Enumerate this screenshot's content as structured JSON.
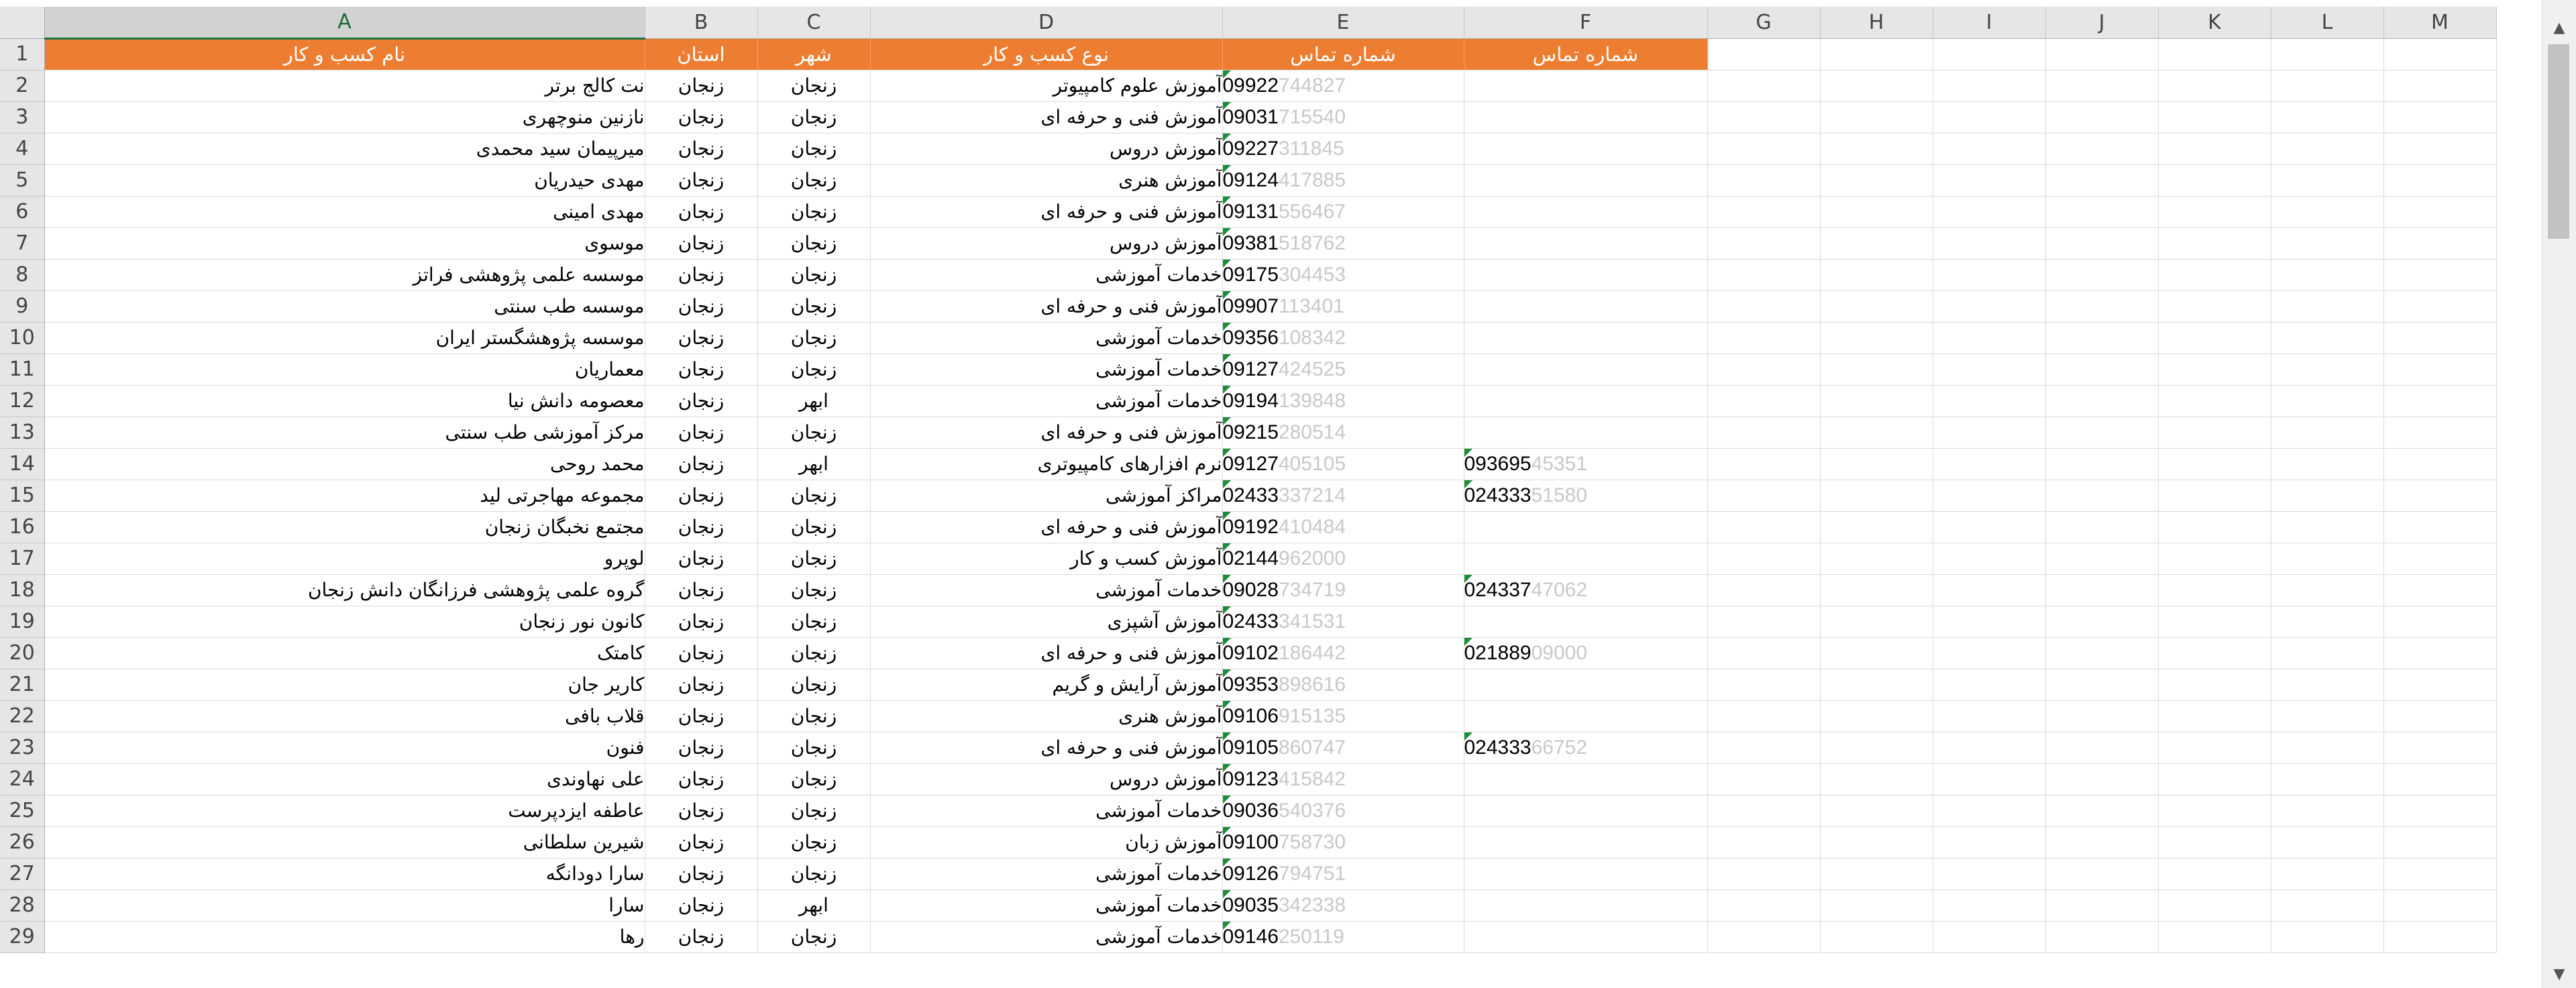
{
  "sheet": {
    "columns": [
      "A",
      "B",
      "C",
      "D",
      "E",
      "F",
      "G",
      "H",
      "I",
      "J",
      "K",
      "L",
      "M"
    ],
    "selected_column": "A",
    "header_row": {
      "row": 1,
      "A": "نام کسب و کار",
      "B": "استان",
      "C": "شهر",
      "D": "نوع کسب و کار",
      "E": "شماره تماس",
      "F": "شماره تماس"
    },
    "rows": [
      {
        "row": 2,
        "A": "نت کالج برتر",
        "B": "زنجان",
        "C": "زنجان",
        "D": "آموزش علوم کامپیوتر",
        "E": "09922",
        "E_fade": "744827",
        "F": "",
        "F_fade": ""
      },
      {
        "row": 3,
        "A": "نازنین منوچهری",
        "B": "زنجان",
        "C": "زنجان",
        "D": "آموزش فنی و حرفه ای",
        "E": "09031",
        "E_fade": "715540",
        "F": "",
        "F_fade": ""
      },
      {
        "row": 4,
        "A": "میرپیمان سید محمدی",
        "B": "زنجان",
        "C": "زنجان",
        "D": "آموزش دروس",
        "E": "09227",
        "E_fade": "311845",
        "F": "",
        "F_fade": ""
      },
      {
        "row": 5,
        "A": "مهدی حیدریان",
        "B": "زنجان",
        "C": "زنجان",
        "D": "آموزش هنری",
        "E": "09124",
        "E_fade": "417885",
        "F": "",
        "F_fade": ""
      },
      {
        "row": 6,
        "A": "مهدی امینی",
        "B": "زنجان",
        "C": "زنجان",
        "D": "آموزش فنی و حرفه ای",
        "E": "09131",
        "E_fade": "556467",
        "F": "",
        "F_fade": ""
      },
      {
        "row": 7,
        "A": "موسوی",
        "B": "زنجان",
        "C": "زنجان",
        "D": "آموزش دروس",
        "E": "09381",
        "E_fade": "518762",
        "F": "",
        "F_fade": ""
      },
      {
        "row": 8,
        "A": "موسسه علمی پژوهشی فراتز",
        "B": "زنجان",
        "C": "زنجان",
        "D": "خدمات آموزشی",
        "E": "09175",
        "E_fade": "304453",
        "F": "",
        "F_fade": ""
      },
      {
        "row": 9,
        "A": "موسسه طب سنتی",
        "B": "زنجان",
        "C": "زنجان",
        "D": "آموزش فنی و حرفه ای",
        "E": "09907",
        "E_fade": "113401",
        "F": "",
        "F_fade": ""
      },
      {
        "row": 10,
        "A": "موسسه پژوهشگستر ایران",
        "B": "زنجان",
        "C": "زنجان",
        "D": "خدمات آموزشی",
        "E": "09356",
        "E_fade": "108342",
        "F": "",
        "F_fade": ""
      },
      {
        "row": 11,
        "A": "معماریان",
        "B": "زنجان",
        "C": "زنجان",
        "D": "خدمات آموزشی",
        "E": "09127",
        "E_fade": "424525",
        "F": "",
        "F_fade": ""
      },
      {
        "row": 12,
        "A": "معصومه دانش نیا",
        "B": "زنجان",
        "C": "ابهر",
        "D": "خدمات آموزشی",
        "E": "09194",
        "E_fade": "139848",
        "F": "",
        "F_fade": ""
      },
      {
        "row": 13,
        "A": "مرکز آموزشی طب سنتی",
        "B": "زنجان",
        "C": "زنجان",
        "D": "آموزش فنی و حرفه ای",
        "E": "09215",
        "E_fade": "280514",
        "F": "",
        "F_fade": ""
      },
      {
        "row": 14,
        "A": "محمد روحی",
        "B": "زنجان",
        "C": "ابهر",
        "D": "نرم افزارهای کامپیوتری",
        "E": "09127",
        "E_fade": "405105",
        "F": "093695",
        "F_fade": "45351"
      },
      {
        "row": 15,
        "A": "مجموعه مهاجرتی لید",
        "B": "زنجان",
        "C": "زنجان",
        "D": "مراکز آموزشی",
        "E": "02433",
        "E_fade": "337214",
        "F": "024333",
        "F_fade": "51580"
      },
      {
        "row": 16,
        "A": "مجتمع نخبگان زنجان",
        "B": "زنجان",
        "C": "زنجان",
        "D": "آموزش فنی و حرفه ای",
        "E": "09192",
        "E_fade": "410484",
        "F": "",
        "F_fade": ""
      },
      {
        "row": 17,
        "A": "لوپرو",
        "B": "زنجان",
        "C": "زنجان",
        "D": "آموزش کسب و کار",
        "E": "02144",
        "E_fade": "962000",
        "F": "",
        "F_fade": ""
      },
      {
        "row": 18,
        "A": "گروه علمی پژوهشی فرزانگان دانش زنجان",
        "B": "زنجان",
        "C": "زنجان",
        "D": "خدمات آموزشی",
        "E": "09028",
        "E_fade": "734719",
        "F": "024337",
        "F_fade": "47062"
      },
      {
        "row": 19,
        "A": "کانون نور زنجان",
        "B": "زنجان",
        "C": "زنجان",
        "D": "آموزش آشپزی",
        "E": "02433",
        "E_fade": "341531",
        "F": "",
        "F_fade": ""
      },
      {
        "row": 20,
        "A": "کامتک",
        "B": "زنجان",
        "C": "زنجان",
        "D": "آموزش فنی و حرفه ای",
        "E": "09102",
        "E_fade": "186442",
        "F": "021889",
        "F_fade": "09000"
      },
      {
        "row": 21,
        "A": "کاریر جان",
        "B": "زنجان",
        "C": "زنجان",
        "D": "آموزش آرایش و گریم",
        "E": "09353",
        "E_fade": "898616",
        "F": "",
        "F_fade": ""
      },
      {
        "row": 22,
        "A": "قلاب بافی",
        "B": "زنجان",
        "C": "زنجان",
        "D": "آموزش هنری",
        "E": "09106",
        "E_fade": "915135",
        "F": "",
        "F_fade": ""
      },
      {
        "row": 23,
        "A": "فنون",
        "B": "زنجان",
        "C": "زنجان",
        "D": "آموزش فنی و حرفه ای",
        "E": "09105",
        "E_fade": "860747",
        "F": "024333",
        "F_fade": "66752"
      },
      {
        "row": 24,
        "A": "علی نهاوندی",
        "B": "زنجان",
        "C": "زنجان",
        "D": "آموزش دروس",
        "E": "09123",
        "E_fade": "415842",
        "F": "",
        "F_fade": ""
      },
      {
        "row": 25,
        "A": "عاطفه ایزدپرست",
        "B": "زنجان",
        "C": "زنجان",
        "D": "خدمات آموزشی",
        "E": "09036",
        "E_fade": "540376",
        "F": "",
        "F_fade": ""
      },
      {
        "row": 26,
        "A": "شیرین سلطانی",
        "B": "زنجان",
        "C": "زنجان",
        "D": "آموزش زبان",
        "E": "09100",
        "E_fade": "758730",
        "F": "",
        "F_fade": ""
      },
      {
        "row": 27,
        "A": "سارا دودانگه",
        "B": "زنجان",
        "C": "زنجان",
        "D": "خدمات آموزشی",
        "E": "09126",
        "E_fade": "794751",
        "F": "",
        "F_fade": ""
      },
      {
        "row": 28,
        "A": "سارا",
        "B": "زنجان",
        "C": "ابهر",
        "D": "خدمات آموزشی",
        "E": "09035",
        "E_fade": "342338",
        "F": "",
        "F_fade": ""
      },
      {
        "row": 29,
        "A": "رها",
        "B": "زنجان",
        "C": "زنجان",
        "D": "خدمات آموزشی",
        "E": "09146",
        "E_fade": "250119",
        "F": "",
        "F_fade": ""
      }
    ]
  },
  "colors": {
    "header_fill": "#ed7d31",
    "header_text": "#ffffff",
    "selected_column_accent": "#217346",
    "comment_indicator": "#1e8a3c"
  },
  "icons": {
    "scroll_up": "chevron-up-icon",
    "scroll_down": "chevron-down-icon"
  }
}
